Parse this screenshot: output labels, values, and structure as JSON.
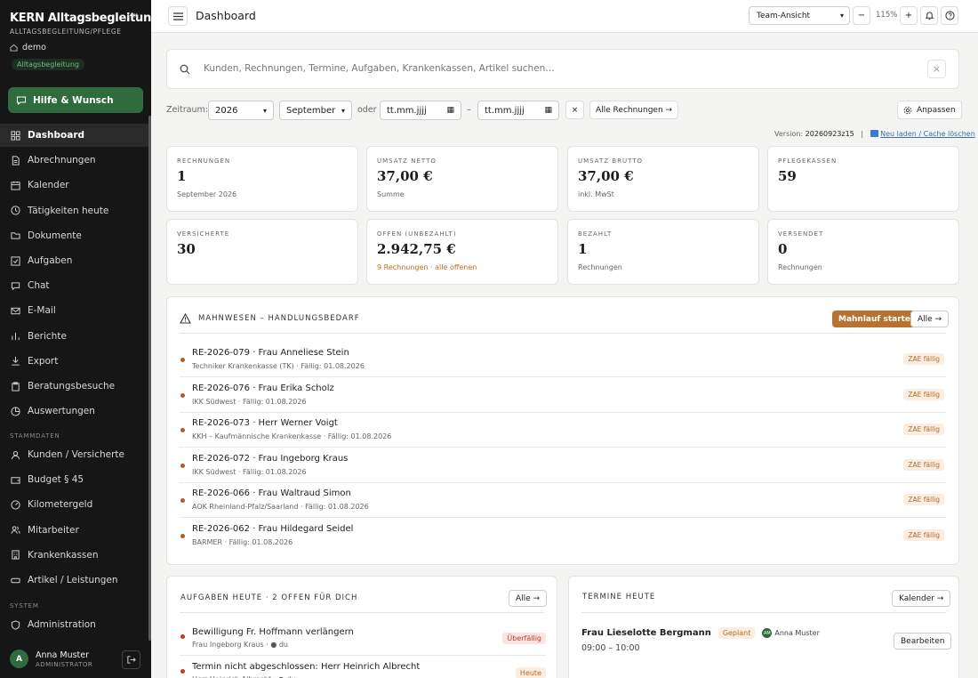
{
  "sidebar": {
    "brand": "KERN Alltagsbegleitung",
    "brand_sub": "ALLTAGSBEGLEITUNG/PFLEGE",
    "tenant": "demo",
    "tenant_badge": "Alltagsbegleitung",
    "help_button": "Hilfe & Wunsch",
    "items": [
      {
        "label": "Dashboard",
        "icon": "grid-icon"
      },
      {
        "label": "Abrechnungen",
        "icon": "file-icon"
      },
      {
        "label": "Kalender",
        "icon": "calendar-icon"
      },
      {
        "label": "Tätigkeiten heute",
        "icon": "clock-icon"
      },
      {
        "label": "Dokumente",
        "icon": "folder-icon"
      },
      {
        "label": "Aufgaben",
        "icon": "checkbox-icon"
      },
      {
        "label": "Chat",
        "icon": "chat-icon"
      },
      {
        "label": "E-Mail",
        "icon": "mail-icon"
      },
      {
        "label": "Berichte",
        "icon": "bar-chart-icon"
      },
      {
        "label": "Export",
        "icon": "download-icon"
      },
      {
        "label": "Beratungsbesuche",
        "icon": "clipboard-icon"
      },
      {
        "label": "Auswertungen",
        "icon": "pie-chart-icon"
      }
    ],
    "section_stammdaten": "STAMMDATEN",
    "stammdaten_items": [
      {
        "label": "Kunden / Versicherte",
        "icon": "user-icon"
      },
      {
        "label": "Budget § 45",
        "icon": "wallet-icon"
      },
      {
        "label": "Kilometergeld",
        "icon": "car-icon"
      },
      {
        "label": "Mitarbeiter",
        "icon": "users-icon"
      },
      {
        "label": "Krankenkassen",
        "icon": "building-icon"
      },
      {
        "label": "Artikel / Leistungen",
        "icon": "tag-icon"
      }
    ],
    "section_system": "SYSTEM",
    "system_items": [
      {
        "label": "Administration",
        "icon": "shield-icon"
      }
    ],
    "user": {
      "initial": "A",
      "name": "Anna Muster",
      "role": "ADMINISTRATOR"
    }
  },
  "topbar": {
    "title": "Dashboard",
    "view_select": "Team-Ansicht",
    "zoom_minus": "−",
    "zoom_level": "115%",
    "zoom_plus": "+"
  },
  "search": {
    "placeholder": "Kunden, Rechnungen, Termine, Aufgaben, Krankenkassen, Artikel suchen…",
    "close": "×"
  },
  "filter": {
    "label": "Zeitraum:",
    "year": "2026",
    "month": "September",
    "or": "oder",
    "date_from": "tt.mm.jjjj",
    "dash": "–",
    "date_to": "tt.mm.jjjj",
    "clear": "×",
    "all_invoices": "Alle Rechnungen →",
    "customize": "Anpassen"
  },
  "version": {
    "label": "Version:",
    "value": "20260923z15",
    "sep": "|",
    "reload": "Neu laden / Cache löschen"
  },
  "stats": [
    {
      "label": "RECHNUNGEN",
      "value": "1",
      "sub": "September 2026",
      "sub_color": "normal"
    },
    {
      "label": "UMSATZ NETTO",
      "value": "37,00 €",
      "sub": "Summe",
      "sub_color": "normal"
    },
    {
      "label": "UMSATZ BRUTTO",
      "value": "37,00 €",
      "sub": "inkl. MwSt",
      "sub_color": "normal"
    },
    {
      "label": "PFLEGEKASSEN",
      "value": "59",
      "sub": "",
      "sub_color": "normal"
    },
    {
      "label": "VERSICHERTE",
      "value": "30",
      "sub": "",
      "sub_color": "normal"
    },
    {
      "label": "OFFEN (UNBEZAHLT)",
      "value": "2.942,75 €",
      "sub": "9 Rechnungen · alle offenen",
      "sub_color": "orange"
    },
    {
      "label": "BEZAHLT",
      "value": "1",
      "sub": "Rechnungen",
      "sub_color": "normal"
    },
    {
      "label": "VERSENDET",
      "value": "0",
      "sub": "Rechnungen",
      "sub_color": "normal"
    }
  ],
  "dunning": {
    "title": "MAHNWESEN – HANDLUNGSBEDARF",
    "start_button": "Mahnlauf starten",
    "all_button": "Alle →",
    "items": [
      {
        "title": "RE-2026-079 · Frau Anneliese Stein",
        "sub": "Techniker Krankenkasse (TK) · Fällig: 01.08.2026",
        "tag": "ZAE fällig"
      },
      {
        "title": "RE-2026-076 · Frau Erika Scholz",
        "sub": "IKK Südwest · Fällig: 01.08.2026",
        "tag": "ZAE fällig"
      },
      {
        "title": "RE-2026-073 · Herr Werner Voigt",
        "sub": "KKH – Kaufmännische Krankenkasse · Fällig: 01.08.2026",
        "tag": "ZAE fällig"
      },
      {
        "title": "RE-2026-072 · Frau Ingeborg Kraus",
        "sub": "IKK Südwest · Fällig: 01.08.2026",
        "tag": "ZAE fällig"
      },
      {
        "title": "RE-2026-066 · Frau Waltraud Simon",
        "sub": "AOK Rheinland-Pfalz/Saarland · Fällig: 01.08.2026",
        "tag": "ZAE fällig"
      },
      {
        "title": "RE-2026-062 · Frau Hildegard Seidel",
        "sub": "BARMER · Fällig: 01.08.2026",
        "tag": "ZAE fällig"
      }
    ]
  },
  "tasks": {
    "title": "AUFGABEN HEUTE · 2 OFFEN FÜR DICH",
    "all_button": "Alle →",
    "items": [
      {
        "title": "Bewilligung Fr. Hoffmann verlängern",
        "sub_name": "Frau Ingeborg Kraus",
        "sub_user": "du",
        "tag": "Überfällig",
        "tag_color": "#c0392b",
        "tag_bg": "#fbe5e2"
      },
      {
        "title": "Termin nicht abgeschlossen: Herr Heinrich Albrecht",
        "sub_name": "Herr Heinrich Albrecht",
        "sub_user": "du",
        "tag": "Heute",
        "tag_color": "#b36a2a",
        "tag_bg": "#fbeee1"
      }
    ]
  },
  "appointments": {
    "title": "TERMINE HEUTE",
    "calendar_button": "Kalender →",
    "items": [
      {
        "name": "Frau Lieselotte Bergmann",
        "status": "Geplant",
        "staff_initials": "AM",
        "staff": "Anna Muster",
        "time": "09:00 – 10:00",
        "edit": "Bearbeiten"
      }
    ]
  },
  "colors": {
    "accent": "#2f6b3d",
    "warn": "#b9712f",
    "sidebar": "#161616"
  }
}
